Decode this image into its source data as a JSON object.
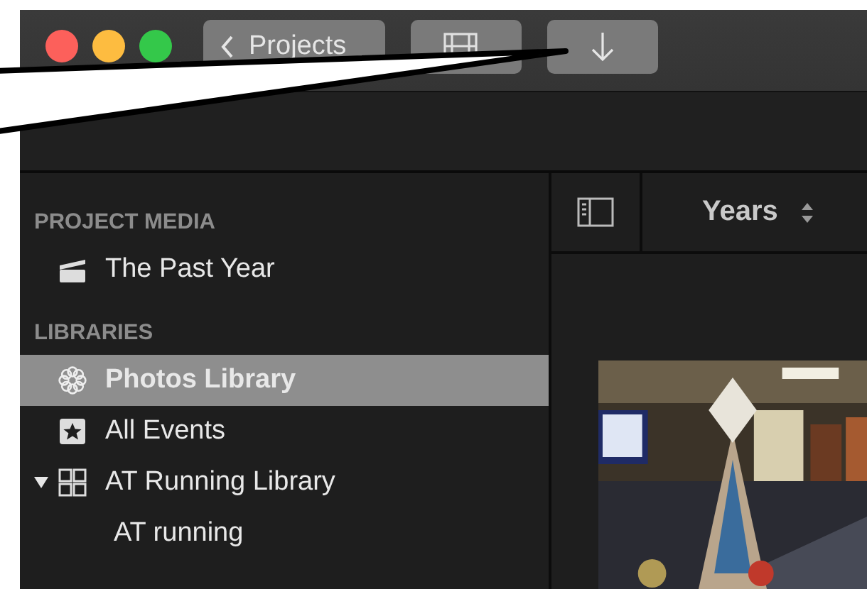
{
  "window": {
    "traffic_lights": [
      {
        "color": "#fc605b"
      },
      {
        "color": "#fdbc40"
      },
      {
        "color": "#34c84a"
      }
    ]
  },
  "toolbar": {
    "buttons": [
      {
        "kind": "back",
        "label": "Projects"
      },
      {
        "kind": "media"
      },
      {
        "kind": "import"
      }
    ]
  },
  "sidebar": {
    "sections": [
      {
        "heading": "PROJECT MEDIA",
        "items": [
          {
            "label": "The Past Year",
            "kind": "clapper",
            "selected": false
          }
        ]
      },
      {
        "heading": "LIBRARIES",
        "items": [
          {
            "label": "Photos Library",
            "kind": "photos",
            "selected": true
          },
          {
            "label": "All Events",
            "kind": "star",
            "selected": false
          },
          {
            "label": "AT Running Library",
            "kind": "library",
            "selected": false,
            "expanded": true,
            "children": [
              {
                "label": "AT running",
                "selected": false
              }
            ]
          }
        ]
      }
    ]
  },
  "browser": {
    "sort_label": "Years"
  }
}
